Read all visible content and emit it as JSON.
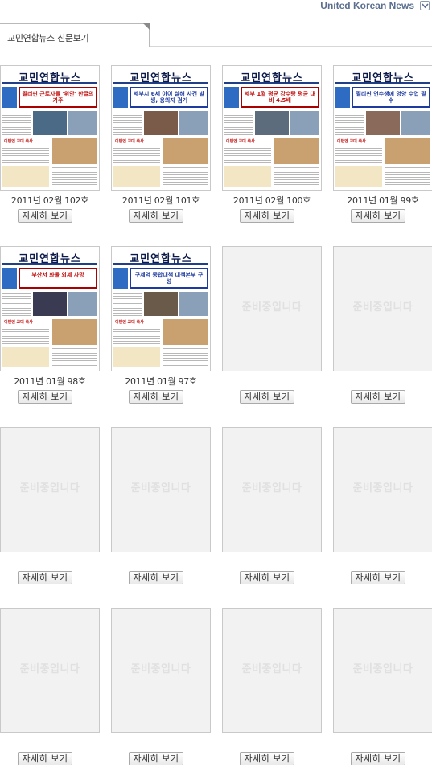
{
  "header": {
    "site_title": "United Korean News",
    "toggle_icon": "chevron-down-icon"
  },
  "tab": {
    "label": "교민연합뉴스 신문보기"
  },
  "issues": [
    {
      "caption": "2011년 02월 102호",
      "button": "자세히 보기",
      "cover": {
        "masthead": "교민연합뉴스",
        "headline": "필리핀 근로자들 '위안' 한글의 가주",
        "section": "이번엔 교대 축사",
        "theme": "red",
        "photo": "#4b6a86"
      }
    },
    {
      "caption": "2011년 02월 101호",
      "button": "자세히 보기",
      "cover": {
        "masthead": "교민연합뉴스",
        "headline": "세부시 6세 아이 살해 사건 발생, 용의자 검거",
        "section": "이번엔 교대 축사",
        "theme": "blue",
        "photo": "#7a5a48"
      }
    },
    {
      "caption": "2011년 02월 100호",
      "button": "자세히 보기",
      "cover": {
        "masthead": "교민연합뉴스",
        "headline": "세부 1월 평균 강수량 평균 대비 4.5배",
        "section": "이번엔 교대 축사",
        "theme": "red",
        "photo": "#5c6c7c"
      }
    },
    {
      "caption": "2011년 01월 99호",
      "button": "자세히 보기",
      "cover": {
        "masthead": "교민연합뉴스",
        "headline": "필리핀 연수생에 영양 수업 필수",
        "section": "이번엔 교대 축사",
        "theme": "blue",
        "photo": "#8a6a5a"
      }
    },
    {
      "caption": "2011년 01월 98호",
      "button": "자세히 보기",
      "cover": {
        "masthead": "교민연합뉴스",
        "headline": "부산서 화물 외제 사망",
        "section": "이번엔 교대 축사",
        "theme": "red",
        "photo": "#3a3a52"
      }
    },
    {
      "caption": "2011년 01월 97호",
      "button": "자세히 보기",
      "cover": {
        "masthead": "교민연합뉴스",
        "headline": "구제역 종합대책 대책본부 구성",
        "section": "이번엔 교대 축사",
        "theme": "blue",
        "photo": "#6a5a4a"
      }
    },
    {
      "caption": "",
      "button": "자세히 보기",
      "placeholder": "준비중입니다"
    },
    {
      "caption": "",
      "button": "자세히 보기",
      "placeholder": "준비중입니다"
    },
    {
      "caption": "",
      "button": "자세히 보기",
      "placeholder": "준비중입니다"
    },
    {
      "caption": "",
      "button": "자세히 보기",
      "placeholder": "준비중입니다"
    },
    {
      "caption": "",
      "button": "자세히 보기",
      "placeholder": "준비중입니다"
    },
    {
      "caption": "",
      "button": "자세히 보기",
      "placeholder": "준비중입니다"
    },
    {
      "caption": "",
      "button": "자세히 보기",
      "placeholder": "준비중입니다"
    },
    {
      "caption": "",
      "button": "자세히 보기",
      "placeholder": "준비중입니다"
    },
    {
      "caption": "",
      "button": "자세히 보기",
      "placeholder": "준비중입니다"
    },
    {
      "caption": "",
      "button": "자세히 보기",
      "placeholder": "준비중입니다"
    }
  ]
}
